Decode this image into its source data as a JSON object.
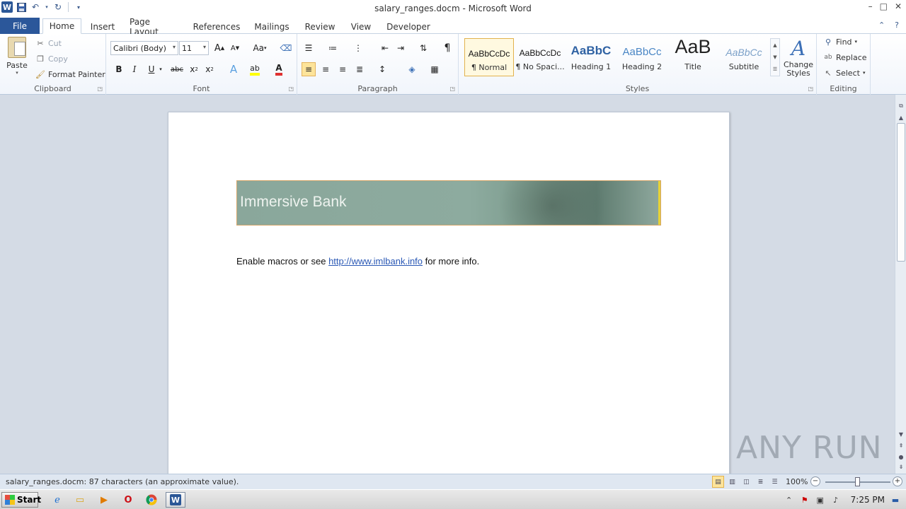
{
  "window": {
    "title": "salary_ranges.docm - Microsoft Word",
    "app_letter": "W"
  },
  "tabs": [
    "File",
    "Home",
    "Insert",
    "Page Layout",
    "References",
    "Mailings",
    "Review",
    "View",
    "Developer"
  ],
  "active_tab": "Home",
  "ribbon": {
    "clipboard": {
      "label": "Clipboard",
      "paste": "Paste",
      "cut": "Cut",
      "copy": "Copy",
      "format_painter": "Format Painter"
    },
    "font": {
      "label": "Font",
      "font_name": "Calibri (Body)",
      "font_size": "11",
      "grow": "A",
      "shrink": "A",
      "change_case": "Aa",
      "bold": "B",
      "italic": "I",
      "underline": "U",
      "strike": "abc",
      "subscript": "x",
      "superscript": "x"
    },
    "paragraph": {
      "label": "Paragraph",
      "pilcrow": "¶"
    },
    "styles": {
      "label": "Styles",
      "items": [
        {
          "sample": "AaBbCcDc",
          "name": "¶ Normal"
        },
        {
          "sample": "AaBbCcDc",
          "name": "¶ No Spaci..."
        },
        {
          "sample": "AaBbC",
          "name": "Heading 1"
        },
        {
          "sample": "AaBbCc",
          "name": "Heading 2"
        },
        {
          "sample": "AaB",
          "name": "Title"
        },
        {
          "sample": "AaBbCc",
          "name": "Subtitle"
        }
      ],
      "change_styles": "Change Styles"
    },
    "editing": {
      "label": "Editing",
      "find": "Find",
      "replace": "Replace",
      "select": "Select"
    }
  },
  "document": {
    "banner_text": "Immersive Bank",
    "line_before": "Enable macros or see ",
    "link": "http://www.imlbank.info",
    "line_after": " for more info."
  },
  "status": {
    "text": "salary_ranges.docm: 87 characters (an approximate value).",
    "zoom": "100%",
    "zoom_fraction": 0.5
  },
  "taskbar": {
    "start": "Start",
    "time": "7:25 PM"
  },
  "watermark": "ANY RUN",
  "colors": {
    "file_tab": "#2b579a",
    "link": "#2a58b5",
    "banner": "#8aa79b"
  }
}
